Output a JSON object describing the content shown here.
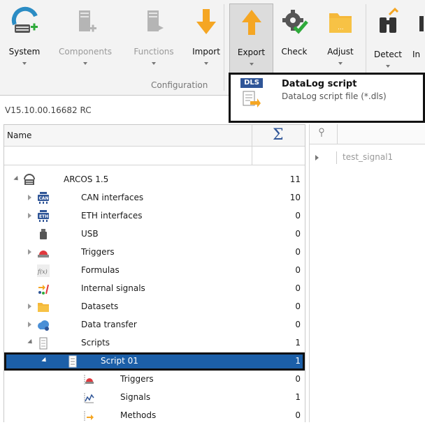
{
  "ribbon": {
    "buttons": [
      {
        "label": "System",
        "icon": "system-icon",
        "disabled": false
      },
      {
        "label": "Components",
        "icon": "components-icon",
        "disabled": true
      },
      {
        "label": "Functions",
        "icon": "functions-icon",
        "disabled": true
      },
      {
        "label": "Import",
        "icon": "import-arrow-icon",
        "disabled": false
      },
      {
        "label": "Export",
        "icon": "export-arrow-icon",
        "disabled": false,
        "pressed": true
      },
      {
        "label": "Check",
        "icon": "check-gear-icon",
        "disabled": false
      },
      {
        "label": "Adjust",
        "icon": "folder-icon",
        "disabled": false
      },
      {
        "label": "Detect",
        "icon": "binoculars-icon",
        "disabled": false
      },
      {
        "label": "In",
        "icon": "partial-icon",
        "disabled": false
      }
    ],
    "group_label": "Configuration"
  },
  "dropdown": {
    "badge": "DLS",
    "title": "DataLog script",
    "description": "DataLog script file (*.dls)"
  },
  "version": "V15.10.00.16682 RC",
  "tree": {
    "column_name": "Name",
    "column_count_symbol": "Σ",
    "rows": [
      {
        "label": "ARCOS 1.5",
        "count": "11",
        "icon": "device-icon",
        "expand": "down"
      },
      {
        "label": "CAN interfaces",
        "count": "10",
        "icon": "can-icon",
        "expand": "right"
      },
      {
        "label": "ETH interfaces",
        "count": "0",
        "icon": "eth-icon",
        "expand": "right"
      },
      {
        "label": "USB",
        "count": "0",
        "icon": "usb-icon",
        "expand": ""
      },
      {
        "label": "Triggers",
        "count": "0",
        "icon": "trigger-icon",
        "expand": "right"
      },
      {
        "label": "Formulas",
        "count": "0",
        "icon": "formula-icon",
        "expand": ""
      },
      {
        "label": "Internal signals",
        "count": "0",
        "icon": "internal-signals-icon",
        "expand": ""
      },
      {
        "label": "Datasets",
        "count": "0",
        "icon": "datasets-icon",
        "expand": "right"
      },
      {
        "label": "Data transfer",
        "count": "0",
        "icon": "cloud-icon",
        "expand": "right"
      },
      {
        "label": "Scripts",
        "count": "1",
        "icon": "scripts-icon",
        "expand": "down"
      },
      {
        "label": "Script 01",
        "count": "1",
        "icon": "script-icon",
        "expand": "down"
      },
      {
        "label": "Triggers",
        "count": "0",
        "icon": "trigger-icon",
        "expand": ""
      },
      {
        "label": "Signals",
        "count": "1",
        "icon": "signals-icon",
        "expand": ""
      },
      {
        "label": "Methods",
        "count": "0",
        "icon": "methods-icon",
        "expand": ""
      }
    ]
  },
  "right_panel": {
    "pin": "📌",
    "row_label": "test_signal1"
  },
  "colors": {
    "selection": "#1c5fa8",
    "accent_orange": "#f5a623",
    "accent_blue": "#2f5597"
  }
}
